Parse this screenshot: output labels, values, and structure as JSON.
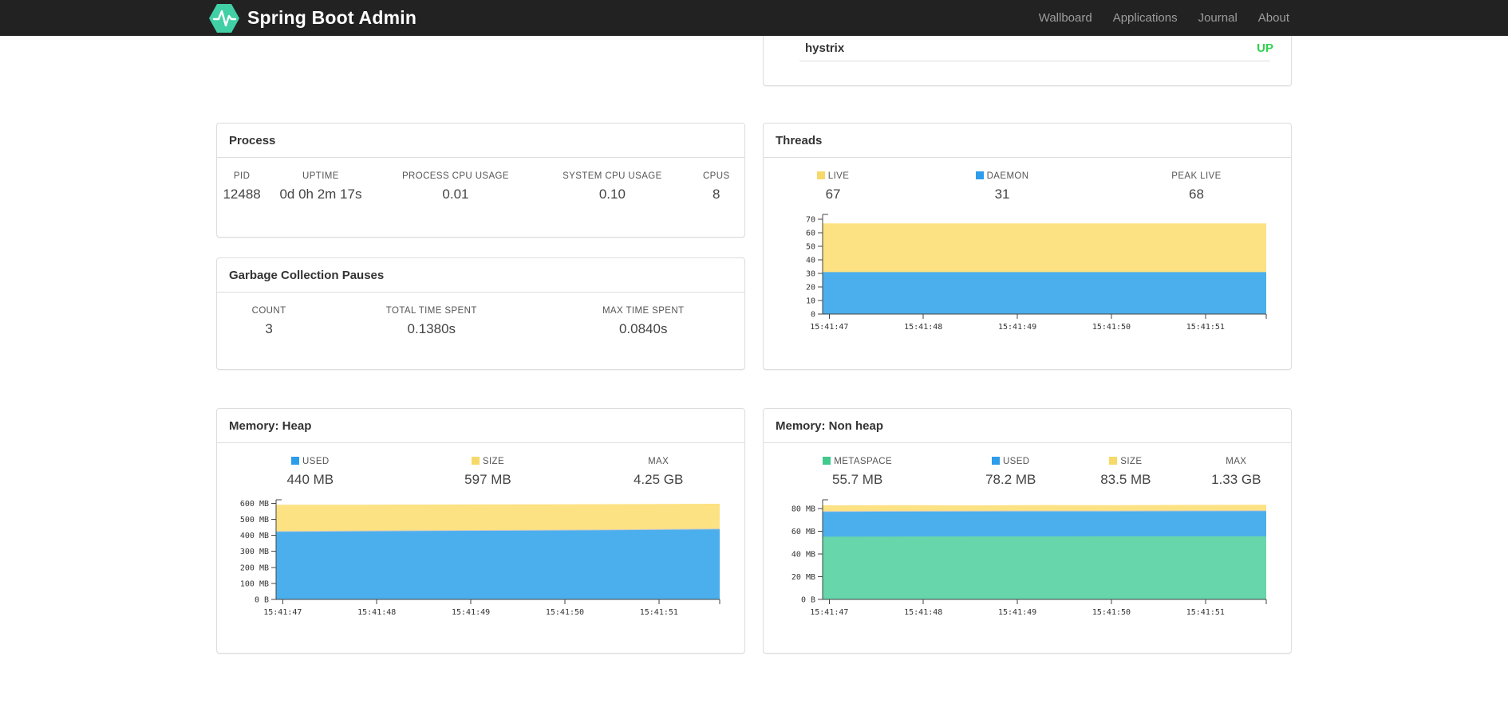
{
  "navbar": {
    "brand": "Spring Boot Admin",
    "brand_color": "#41d0a5",
    "links": [
      "Wallboard",
      "Applications",
      "Journal",
      "About"
    ]
  },
  "application_panel": {
    "name": "hystrix",
    "status": "UP",
    "status_color": "#2fd24d"
  },
  "process": {
    "title": "Process",
    "metrics": [
      {
        "label": "PID",
        "value": "12488"
      },
      {
        "label": "UPTIME",
        "value": "0d 0h 2m 17s"
      },
      {
        "label": "PROCESS CPU USAGE",
        "value": "0.01"
      },
      {
        "label": "SYSTEM CPU USAGE",
        "value": "0.10"
      },
      {
        "label": "CPUS",
        "value": "8"
      }
    ]
  },
  "gc": {
    "title": "Garbage Collection Pauses",
    "metrics": [
      {
        "label": "COUNT",
        "value": "3"
      },
      {
        "label": "TOTAL TIME SPENT",
        "value": "0.1380s"
      },
      {
        "label": "MAX TIME SPENT",
        "value": "0.0840s"
      }
    ]
  },
  "threads": {
    "title": "Threads",
    "metrics": [
      {
        "label": "LIVE",
        "value": "67",
        "swatch": "#f6d969"
      },
      {
        "label": "DAEMON",
        "value": "31",
        "swatch": "#2d9ceb"
      },
      {
        "label": "PEAK LIVE",
        "value": "68"
      }
    ]
  },
  "heap": {
    "title": "Memory: Heap",
    "metrics": [
      {
        "label": "USED",
        "value": "440 MB",
        "swatch": "#2d9ceb"
      },
      {
        "label": "SIZE",
        "value": "597 MB",
        "swatch": "#f6d969"
      },
      {
        "label": "MAX",
        "value": "4.25 GB"
      }
    ]
  },
  "nonheap": {
    "title": "Memory: Non heap",
    "metrics": [
      {
        "label": "METASPACE",
        "value": "55.7 MB",
        "swatch": "#41c98e"
      },
      {
        "label": "USED",
        "value": "78.2 MB",
        "swatch": "#2d9ceb"
      },
      {
        "label": "SIZE",
        "value": "83.5 MB",
        "swatch": "#f6d969"
      },
      {
        "label": "MAX",
        "value": "1.33 GB"
      }
    ]
  },
  "chart_data": [
    {
      "id": "threads",
      "type": "area",
      "title": "Threads",
      "x_ticks": [
        {
          "pos": 0.015,
          "label": "15:41:47"
        },
        {
          "pos": 0.227,
          "label": "15:41:48"
        },
        {
          "pos": 0.439,
          "label": "15:41:49"
        },
        {
          "pos": 0.651,
          "label": "15:41:50"
        },
        {
          "pos": 0.863,
          "label": "15:41:51"
        }
      ],
      "y_ticks": [
        {
          "v": 0,
          "label": "0"
        },
        {
          "v": 10,
          "label": "10"
        },
        {
          "v": 20,
          "label": "20"
        },
        {
          "v": 30,
          "label": "30"
        },
        {
          "v": 40,
          "label": "40"
        },
        {
          "v": 50,
          "label": "50"
        },
        {
          "v": 60,
          "label": "60"
        },
        {
          "v": 70,
          "label": "70"
        }
      ],
      "y_plot_max": 72.5,
      "series": [
        {
          "name": "LIVE",
          "color": "#fde283",
          "values": [
            67,
            67,
            67,
            67,
            67,
            67,
            67
          ]
        },
        {
          "name": "DAEMON",
          "color": "#4cafed",
          "values": [
            31,
            31,
            31,
            31,
            31,
            31,
            31
          ]
        }
      ]
    },
    {
      "id": "memory-heap",
      "type": "area",
      "title": "Memory: Heap",
      "x_ticks": [
        {
          "pos": 0.015,
          "label": "15:41:47"
        },
        {
          "pos": 0.227,
          "label": "15:41:48"
        },
        {
          "pos": 0.439,
          "label": "15:41:49"
        },
        {
          "pos": 0.651,
          "label": "15:41:50"
        },
        {
          "pos": 0.863,
          "label": "15:41:51"
        }
      ],
      "y_ticks": [
        {
          "v": 0,
          "label": "0 B"
        },
        {
          "v": 100,
          "label": "100 MB"
        },
        {
          "v": 200,
          "label": "200 MB"
        },
        {
          "v": 300,
          "label": "300 MB"
        },
        {
          "v": 400,
          "label": "400 MB"
        },
        {
          "v": 500,
          "label": "500 MB"
        },
        {
          "v": 600,
          "label": "600 MB"
        }
      ],
      "y_plot_max": 612,
      "series": [
        {
          "name": "SIZE",
          "color": "#fde283",
          "values": [
            591,
            591,
            592,
            593,
            594,
            595,
            597
          ]
        },
        {
          "name": "USED",
          "color": "#4cafed",
          "top_stroke": "#c9c9c9",
          "values": [
            424,
            427,
            429,
            431,
            433,
            436,
            440
          ]
        }
      ]
    },
    {
      "id": "memory-nonheap",
      "type": "area",
      "title": "Memory: Non heap",
      "x_ticks": [
        {
          "pos": 0.015,
          "label": "15:41:47"
        },
        {
          "pos": 0.227,
          "label": "15:41:48"
        },
        {
          "pos": 0.439,
          "label": "15:41:49"
        },
        {
          "pos": 0.651,
          "label": "15:41:50"
        },
        {
          "pos": 0.863,
          "label": "15:41:51"
        }
      ],
      "y_ticks": [
        {
          "v": 0,
          "label": "0 B"
        },
        {
          "v": 20,
          "label": "20 MB"
        },
        {
          "v": 40,
          "label": "40 MB"
        },
        {
          "v": 60,
          "label": "60 MB"
        },
        {
          "v": 80,
          "label": "80 MB"
        }
      ],
      "y_plot_max": 86.5,
      "series": [
        {
          "name": "SIZE",
          "color": "#fde283",
          "values": [
            83.0,
            83.2,
            83.0,
            83.3,
            83.2,
            83.4,
            83.5
          ]
        },
        {
          "name": "USED",
          "color": "#4cafed",
          "top_stroke": "#c9c9c9",
          "values": [
            77.6,
            77.8,
            77.9,
            78.0,
            78.0,
            78.1,
            78.2
          ]
        },
        {
          "name": "METASPACE",
          "color": "#67d6ab",
          "values": [
            55.4,
            55.5,
            55.6,
            55.6,
            55.7,
            55.7,
            55.7
          ]
        }
      ]
    }
  ]
}
